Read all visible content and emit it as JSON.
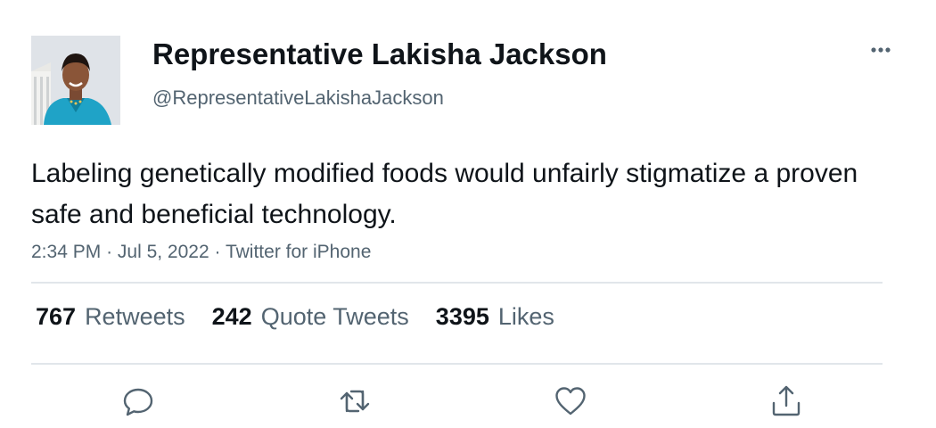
{
  "author": {
    "display_name": "Representative Lakisha Jackson",
    "handle": "@RepresentativeLakishaJackson",
    "avatar_icon": "profile-photo"
  },
  "tweet": {
    "text": "Labeling genetically modified foods would unfairly stigmatize a proven safe and beneficial technology.",
    "time": "2:34 PM",
    "date": "Jul 5, 2022",
    "source": "Twitter for iPhone",
    "separator": "·"
  },
  "stats": {
    "retweets": {
      "count": "767",
      "label": "Retweets"
    },
    "quote_tweets": {
      "count": "242",
      "label": "Quote Tweets"
    },
    "likes": {
      "count": "3395",
      "label": "Likes"
    }
  },
  "actions": [
    "reply-icon",
    "retweet-icon",
    "like-icon",
    "share-icon"
  ],
  "colors": {
    "text_primary": "#0f1419",
    "text_secondary": "#536471",
    "divider": "#e1e6ea"
  }
}
